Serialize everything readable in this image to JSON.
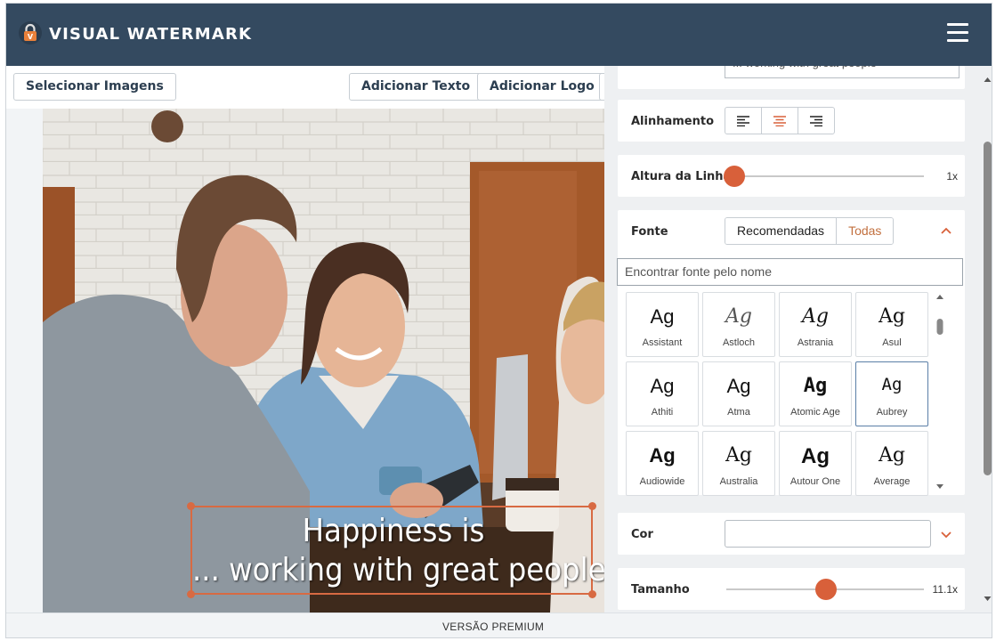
{
  "app": {
    "title": "VISUAL WATERMARK"
  },
  "toolbar": {
    "select_images": "Selecionar Imagens",
    "add_text": "Adicionar Texto",
    "add_logo": "Adicionar Logo"
  },
  "watermark": {
    "line1": "Happiness is",
    "line2": "... working with great people"
  },
  "footer": {
    "premium": "VERSÃO PREMIUM"
  },
  "panel": {
    "text_value": "... working with great people",
    "alignment": {
      "label": "Alinhamento",
      "options": [
        "left",
        "center",
        "right"
      ],
      "selected": "center"
    },
    "line_height": {
      "label": "Altura da Linha",
      "value": "1x",
      "fraction": 0.0
    },
    "font": {
      "label": "Fonte",
      "tabs": [
        "Recomendadas",
        "Todas"
      ],
      "active_tab": "Recomendadas",
      "search_placeholder": "Encontrar fonte pelo nome",
      "sample": "Ag",
      "fonts": [
        {
          "name": "Assistant"
        },
        {
          "name": "Astloch"
        },
        {
          "name": "Astrania"
        },
        {
          "name": "Asul"
        },
        {
          "name": "Athiti"
        },
        {
          "name": "Atma"
        },
        {
          "name": "Atomic Age"
        },
        {
          "name": "Aubrey",
          "selected": true
        },
        {
          "name": "Audiowide"
        },
        {
          "name": "Australia"
        },
        {
          "name": "Autour One"
        },
        {
          "name": "Average"
        }
      ]
    },
    "color": {
      "label": "Cor",
      "value": ""
    },
    "size": {
      "label": "Tamanho",
      "value": "11.1x",
      "fraction": 0.5
    }
  },
  "colors": {
    "header": "#344a60",
    "accent": "#d8603a",
    "panel_bg": "#eef0f2"
  }
}
